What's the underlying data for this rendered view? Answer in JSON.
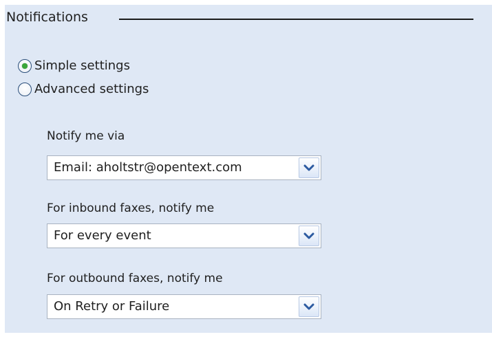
{
  "fieldset": {
    "legend": "Notifications"
  },
  "mode": {
    "options": [
      {
        "label": "Simple settings",
        "selected": true
      },
      {
        "label": "Advanced settings",
        "selected": false
      }
    ]
  },
  "notify_via": {
    "label": "Notify me via",
    "value": "Email: aholtstr@opentext.com"
  },
  "inbound": {
    "label": "For inbound faxes, notify me",
    "value": "For every event"
  },
  "outbound": {
    "label": "For outbound faxes, notify me",
    "value": "On Retry or Failure"
  },
  "icons": {
    "dropdown": "chevron-down-icon",
    "radio_selected": "radio-selected-icon",
    "radio_unselected": "radio-unselected-icon"
  },
  "colors": {
    "panel_background": "#dfe8f5",
    "radio_dot": "#3aa63a",
    "chevron": "#2c5aa0"
  }
}
